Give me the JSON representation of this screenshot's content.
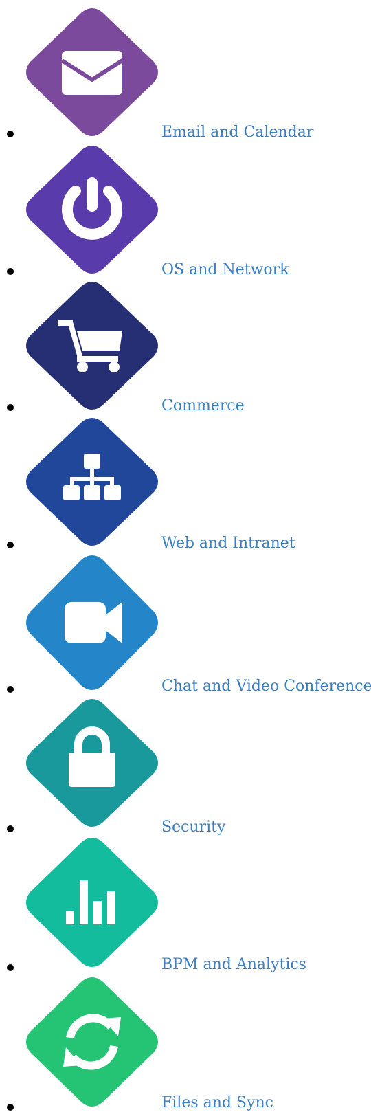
{
  "link_color": "#3a7dc0",
  "items": [
    {
      "label": "Email and Calendar",
      "icon": "envelope-icon",
      "color": "#7b4a9c"
    },
    {
      "label": "OS and Network",
      "icon": "power-icon",
      "color": "#5a3bab"
    },
    {
      "label": "Commerce",
      "icon": "shopping-cart-icon",
      "color": "#262e74"
    },
    {
      "label": "Web and Intranet",
      "icon": "sitemap-icon",
      "color": "#21479b"
    },
    {
      "label": "Chat and Video Conference",
      "icon": "video-camera-icon",
      "color": "#2486c9"
    },
    {
      "label": "Security",
      "icon": "lock-icon",
      "color": "#1a999c"
    },
    {
      "label": "BPM and Analytics",
      "icon": "bar-chart-icon",
      "color": "#12bc9c"
    },
    {
      "label": "Files and Sync",
      "icon": "sync-icon",
      "color": "#24c474"
    }
  ]
}
